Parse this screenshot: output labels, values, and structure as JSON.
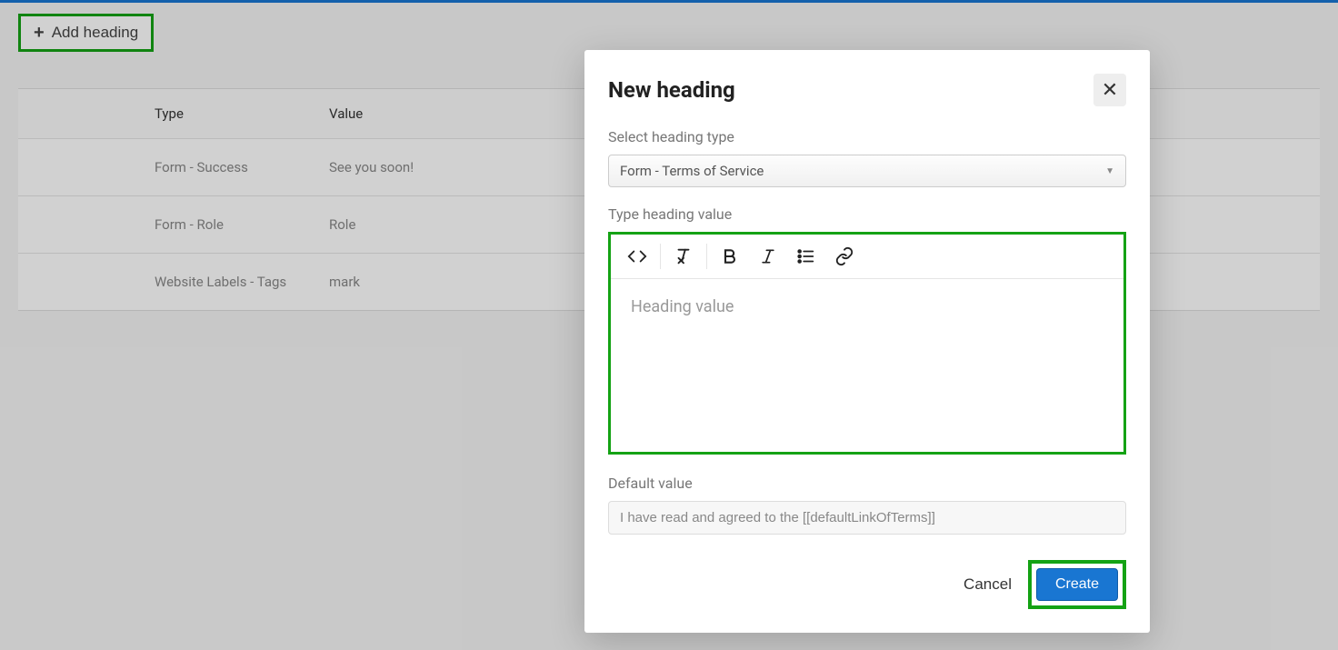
{
  "toolbar": {
    "add_heading_label": "Add heading"
  },
  "table": {
    "columns": {
      "type": "Type",
      "value": "Value"
    },
    "rows": [
      {
        "type": "Form - Success",
        "value": "See you soon!"
      },
      {
        "type": "Form - Role",
        "value": "Role"
      },
      {
        "type": "Website Labels - Tags",
        "value": "mark"
      }
    ]
  },
  "modal": {
    "title": "New heading",
    "select_label": "Select heading type",
    "select_value": "Form - Terms of Service",
    "type_label": "Type heading value",
    "editor_placeholder": "Heading value",
    "default_label": "Default value",
    "default_value": "I have read and agreed to the [[defaultLinkOfTerms]]",
    "cancel_label": "Cancel",
    "create_label": "Create"
  }
}
